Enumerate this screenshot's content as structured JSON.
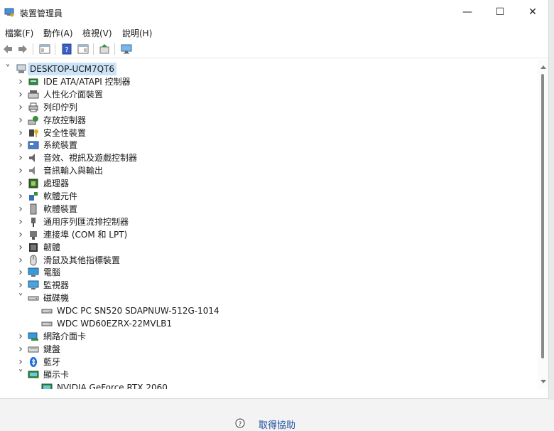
{
  "window": {
    "title": "裝置管理員",
    "minimize": "—",
    "maximize": "☐",
    "close": "✕"
  },
  "menu": {
    "items": [
      "檔案(F)",
      "動作(A)",
      "檢視(V)",
      "說明(H)"
    ]
  },
  "tree": {
    "root": "DESKTOP-UCM7QT6",
    "categories": [
      {
        "label": "IDE ATA/ATAPI 控制器",
        "icon": "ide-controller-icon"
      },
      {
        "label": "人性化介面裝置",
        "icon": "hid-icon"
      },
      {
        "label": "列印佇列",
        "icon": "printer-icon"
      },
      {
        "label": "存放控制器",
        "icon": "storage-controller-icon"
      },
      {
        "label": "安全性裝置",
        "icon": "security-key-icon"
      },
      {
        "label": "系統裝置",
        "icon": "system-device-icon"
      },
      {
        "label": "音效、視訊及遊戲控制器",
        "icon": "speaker-icon"
      },
      {
        "label": "音訊輸入與輸出",
        "icon": "audio-io-icon"
      },
      {
        "label": "處理器",
        "icon": "processor-icon"
      },
      {
        "label": "軟體元件",
        "icon": "software-component-icon"
      },
      {
        "label": "軟體裝置",
        "icon": "software-device-icon"
      },
      {
        "label": "通用序列匯流排控制器",
        "icon": "usb-icon"
      },
      {
        "label": "連接埠 (COM 和 LPT)",
        "icon": "port-icon"
      },
      {
        "label": "韌體",
        "icon": "firmware-icon"
      },
      {
        "label": "滑鼠及其他指標裝置",
        "icon": "mouse-icon"
      },
      {
        "label": "電腦",
        "icon": "computer-icon"
      },
      {
        "label": "監視器",
        "icon": "monitor-icon"
      }
    ],
    "disk": {
      "label": "磁碟機",
      "children": [
        "WDC PC SN520 SDAPNUW-512G-1014",
        "WDC WD60EZRX-22MVLB1"
      ]
    },
    "after_disk": [
      {
        "label": "網路介面卡",
        "icon": "network-adapter-icon"
      },
      {
        "label": "鍵盤",
        "icon": "keyboard-icon"
      },
      {
        "label": "藍牙",
        "icon": "bluetooth-icon"
      }
    ],
    "display": {
      "label": "顯示卡",
      "children": [
        "NVIDIA GeForce RTX 2060"
      ]
    }
  },
  "footer": {
    "help": "取得協助"
  },
  "colors": {
    "selection": "#cce4f7",
    "accent": "#1a4e9c"
  }
}
